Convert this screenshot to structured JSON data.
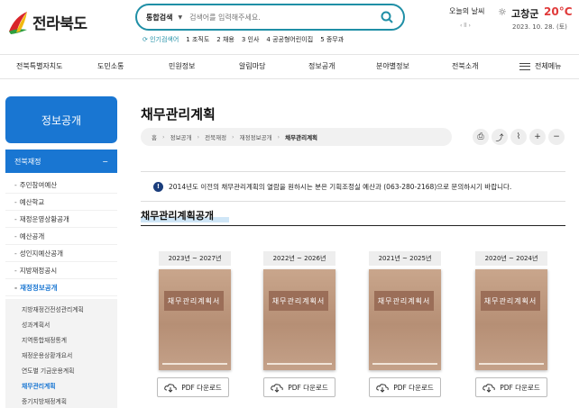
{
  "header": {
    "logo_text": "전라북도",
    "search": {
      "scope": "통합검색",
      "placeholder": "검색어를 입력해주세요."
    },
    "popular": {
      "label": "인기검색어",
      "items": [
        "1 조직도",
        "2 채용",
        "3 인사",
        "4 공공형어린이집",
        "5 종무과"
      ]
    },
    "weather": {
      "label": "오늘의 날씨",
      "controls": "‹ ll ›",
      "location": "고창군",
      "temperature": "20°C",
      "date": "2023. 10. 28. (토)"
    }
  },
  "gnb": {
    "items": [
      "전북특별자치도",
      "도민소통",
      "민원정보",
      "알림마당",
      "정보공개",
      "분야별정보",
      "전북소개"
    ],
    "all_menu": "전체메뉴"
  },
  "sidebar": {
    "title": "정보공개",
    "section": "전북재정",
    "section_toggle": "−",
    "items": [
      {
        "label": "주민참여예산",
        "active": false
      },
      {
        "label": "예산학교",
        "active": false
      },
      {
        "label": "재정운영상황공개",
        "active": false
      },
      {
        "label": "예산공개",
        "active": false
      },
      {
        "label": "성인지예산공개",
        "active": false
      },
      {
        "label": "지방재정공시",
        "active": false
      },
      {
        "label": "재정정보공개",
        "active": true
      }
    ],
    "sub_items": [
      {
        "label": "지방재정건전성관리계획",
        "active": false
      },
      {
        "label": "성과계획서",
        "active": false
      },
      {
        "label": "지역통합재정통계",
        "active": false
      },
      {
        "label": "재정운용상황개요서",
        "active": false
      },
      {
        "label": "연도별 기금운용계획",
        "active": false
      },
      {
        "label": "채무관리계획",
        "active": true
      },
      {
        "label": "중기지방재정계획",
        "active": false
      }
    ]
  },
  "content": {
    "title": "채무관리계획",
    "breadcrumb": [
      "홈",
      "정보공개",
      "전북재정",
      "재정정보공개",
      "채무관리계획"
    ],
    "notice": "2014년도 이전의 채무관리계획의 열람을 원하시는 분은 기획조정실 예산과 (063-280-2168)으로 문의하시기 바랍니다.",
    "section_title": "채무관리계획공개",
    "book_title": "채무관리계획서",
    "pdf_label": "PDF 다운로드",
    "plans": [
      {
        "period": "2023년 ~ 2027년"
      },
      {
        "period": "2022년 ~ 2026년"
      },
      {
        "period": "2021년 ~ 2025년"
      },
      {
        "period": "2020년 ~ 2024년"
      }
    ]
  },
  "colors": {
    "brand_blue": "#1976d2",
    "search_border": "#1f8fa6",
    "temperature": "#e03a3a",
    "book": "#b68f75"
  }
}
